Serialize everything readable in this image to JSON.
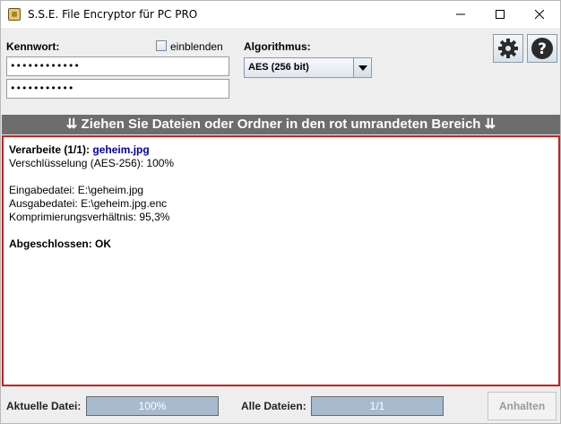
{
  "window": {
    "title": "S.S.E. File Encryptor für PC PRO",
    "app_icon_glyph": "▥"
  },
  "password": {
    "label": "Kennwort:",
    "field1_value": "••••••••••••",
    "field2_value": "•••••••••••",
    "show_label": "einblenden",
    "show_checked": false
  },
  "algorithm": {
    "label": "Algorithmus:",
    "selected": "AES (256 bit)"
  },
  "toolbar": {
    "settings_icon": "gear-icon",
    "help_icon": "question-icon"
  },
  "banner": {
    "text": "⇊ Ziehen Sie Dateien oder Ordner in den rot umrandeten Bereich ⇊"
  },
  "log": {
    "processing_label": "Verarbeite (1/1): ",
    "processing_file": "geheim.jpg",
    "encryption_line": "Verschlüsselung (AES-256): 100%",
    "input_line": "Eingabedatei: E:\\geheim.jpg",
    "output_line": "Ausgabedatei: E:\\geheim.jpg.enc",
    "compression_line": "Komprimierungsverhältnis: 95,3%",
    "done_line": "Abgeschlossen: OK"
  },
  "status": {
    "current_file_label": "Aktuelle Datei:",
    "current_file_progress_text": "100%",
    "current_file_progress": 1.0,
    "all_files_label": "Alle Dateien:",
    "all_files_progress_text": "1/1",
    "all_files_progress": 1.0,
    "stop_button_label": "Anhalten"
  },
  "colors": {
    "banner_bg": "#6d6d6d",
    "drop_border": "#c82020",
    "file_name": "#0000a8",
    "progress_fill": "#a8bacd"
  }
}
